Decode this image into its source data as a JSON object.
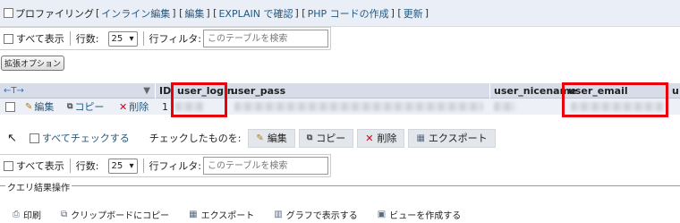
{
  "profiling_bar": {
    "items": [
      {
        "text": "プロファイリング",
        "link": false
      },
      {
        "text": "[",
        "link": false
      },
      {
        "text": "インライン編集",
        "link": true
      },
      {
        "text": "] [",
        "link": false
      },
      {
        "text": "編集",
        "link": true
      },
      {
        "text": "] [",
        "link": false
      },
      {
        "text": "EXPLAIN で確認",
        "link": true
      },
      {
        "text": "] [",
        "link": false
      },
      {
        "text": "PHP コードの作成",
        "link": true
      },
      {
        "text": "] [",
        "link": false
      },
      {
        "text": "更新",
        "link": true
      },
      {
        "text": "]",
        "link": false
      }
    ]
  },
  "nav_top": {
    "show_all": "すべて表示",
    "rows_label": "行数:",
    "rows_value": "25",
    "filter_label": "行フィルタ:",
    "filter_placeholder": "このテーブルを検索"
  },
  "extended_options": "拡張オプション",
  "table": {
    "sort_arrows": "←T→",
    "columns": [
      "ID",
      "user_login",
      "user_pass",
      "user_nicename",
      "user_email",
      "u"
    ],
    "row": {
      "edit": "編集",
      "copy": "コピー",
      "delete": "削除",
      "id": "1"
    }
  },
  "check_all": {
    "label": "すべてチェックする",
    "with_selected": "チェックしたものを:",
    "buttons": [
      "編集",
      "コピー",
      "削除",
      "エクスポート"
    ]
  },
  "nav_bottom": {
    "show_all": "すべて表示",
    "rows_label": "行数:",
    "rows_value": "25",
    "filter_label": "行フィルタ:",
    "filter_placeholder": "このテーブルを検索"
  },
  "query_ops": {
    "legend": "クエリ結果操作",
    "items": [
      {
        "icon": "print-icon",
        "label": "印刷"
      },
      {
        "icon": "clipboard-icon",
        "label": "クリップボードにコピー"
      },
      {
        "icon": "export-icon",
        "label": "エクスポート"
      },
      {
        "icon": "chart-icon",
        "label": "グラフで表示する"
      },
      {
        "icon": "view-icon",
        "label": "ビューを作成する"
      }
    ]
  },
  "colors": {
    "link": "#235a81",
    "highlight": "#e8000b",
    "header_bg": "#d6dde9"
  }
}
